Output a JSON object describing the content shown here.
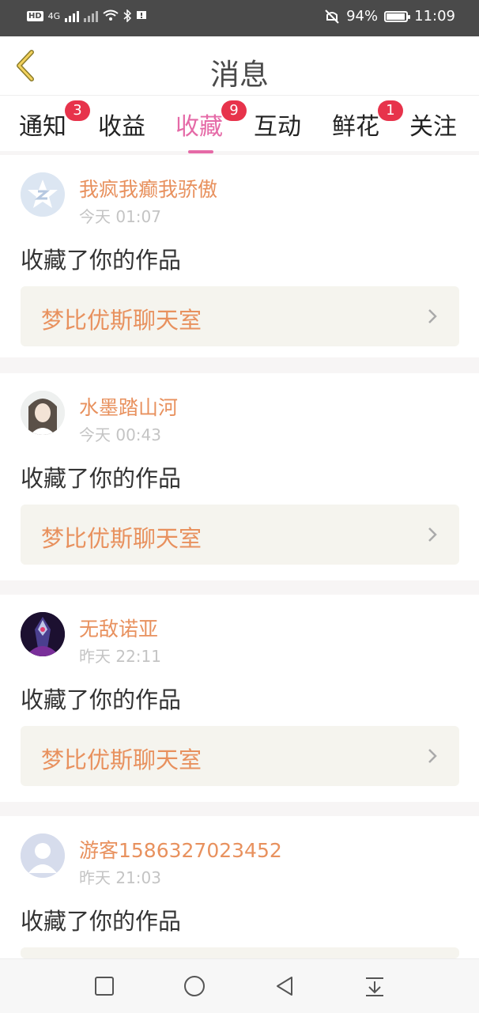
{
  "status_bar": {
    "left_badges": [
      "HD",
      "4G"
    ],
    "battery": "94%",
    "battery_level": 0.94,
    "time": "11:09",
    "icons": [
      "signal-icon",
      "wifi-icon",
      "bluetooth-icon",
      "notification-icon",
      "mute-icon",
      "battery-icon"
    ]
  },
  "header": {
    "title": "消息",
    "back_icon": "chevron-left-icon"
  },
  "tabs": [
    {
      "label": "通知",
      "badge": "3"
    },
    {
      "label": "收益",
      "badge": ""
    },
    {
      "label": "收藏",
      "badge": "9",
      "active": true
    },
    {
      "label": "互动",
      "badge": ""
    },
    {
      "label": "鲜花",
      "badge": "1"
    },
    {
      "label": "关注",
      "badge": ""
    }
  ],
  "colors": {
    "accent": "#e56aa7",
    "username": "#e8915e",
    "badge": "#e7334b"
  },
  "messages": [
    {
      "username": "我疯我癫我骄傲",
      "time": "今天 01:07",
      "action": "收藏了你的作品",
      "work": "梦比优斯聊天室"
    },
    {
      "username": "水墨踏山河",
      "time": "今天 00:43",
      "action": "收藏了你的作品",
      "work": "梦比优斯聊天室"
    },
    {
      "username": "无敌诺亚",
      "time": "昨天 22:11",
      "action": "收藏了你的作品",
      "work": "梦比优斯聊天室"
    },
    {
      "username": "游客1586327023452",
      "time": "昨天 21:03",
      "action": "收藏了你的作品",
      "work": ""
    }
  ],
  "nav_bar": {
    "icons": [
      "square-icon",
      "circle-icon",
      "triangle-back-icon",
      "collapse-icon"
    ]
  }
}
